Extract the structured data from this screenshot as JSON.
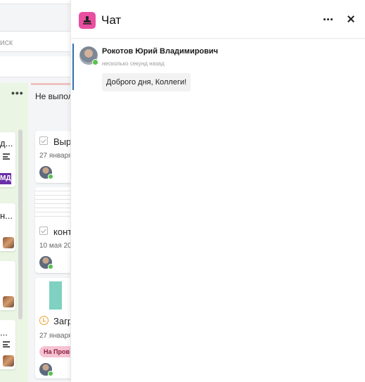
{
  "background": {
    "search_placeholder": "иск",
    "column_a": {
      "menu_label": "•••",
      "card1_title": "д...",
      "tag_label": "МД",
      "card2_title": "н...",
      "card3_title": "..."
    },
    "column_b": {
      "title": "Не выпол",
      "cards": [
        {
          "title": "Выр",
          "date": "27 января"
        },
        {
          "title": "конт",
          "date": "10 мая 20"
        },
        {
          "title": "Загр",
          "date": "27 января",
          "badge": "На Пров"
        }
      ]
    }
  },
  "chat": {
    "title": "Чат",
    "colors": {
      "logo": "#e94fa0",
      "online": "#58c34b",
      "accent": "#2f6fb1"
    },
    "messages": [
      {
        "author": "Рокотов Юрий Владимирович",
        "time": "несколько секунд назад",
        "text": "Доброго дня, Коллеги!"
      }
    ]
  }
}
